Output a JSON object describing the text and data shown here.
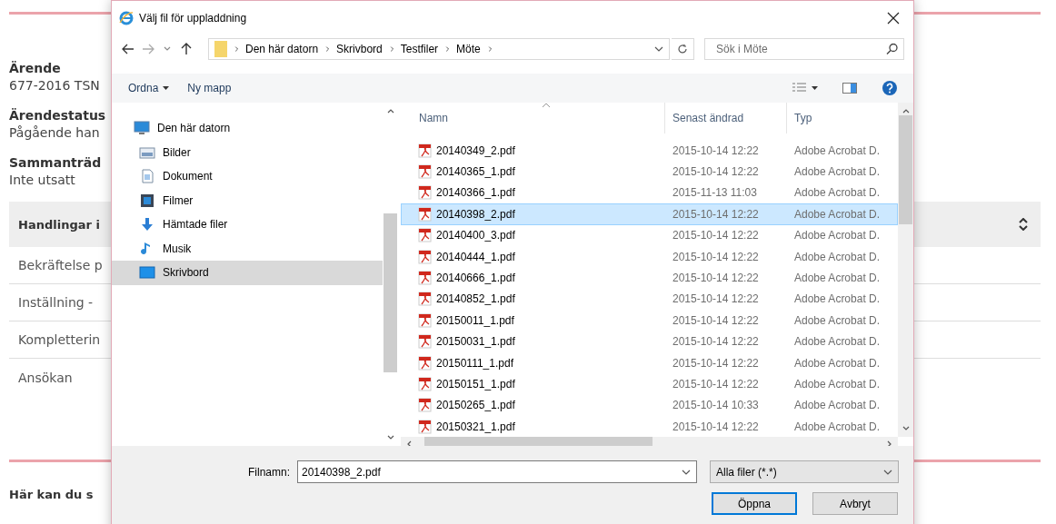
{
  "page": {
    "fields": [
      {
        "label": "Ärende",
        "value": "677-2016 TSN"
      },
      {
        "label": "Ärendestatus",
        "value": "Pågående han"
      },
      {
        "label": "Sammanträd",
        "value": "Inte utsatt"
      }
    ],
    "section": {
      "title": "Handlingar i",
      "rows": [
        "Bekräftelse p",
        "Inställning -",
        "Kompletterin",
        "Ansökan"
      ]
    },
    "footer_heading": "Här kan du s"
  },
  "dialog": {
    "title": "Välj fil för uppladdning",
    "breadcrumb": [
      "Den här datorn",
      "Skrivbord",
      "Testfiler",
      "Möte"
    ],
    "search": {
      "placeholder": "Sök i Möte"
    },
    "toolbar": [
      {
        "label": "Ordna",
        "kind": "menu"
      },
      {
        "label": "Ny mapp",
        "kind": "button"
      }
    ],
    "nav": [
      {
        "label": "Den här datorn",
        "kind": "computer",
        "selected": false
      },
      {
        "label": "Bilder",
        "kind": "pictures",
        "selected": false
      },
      {
        "label": "Dokument",
        "kind": "document",
        "selected": false
      },
      {
        "label": "Filmer",
        "kind": "video",
        "selected": false
      },
      {
        "label": "Hämtade filer",
        "kind": "download",
        "selected": false
      },
      {
        "label": "Musik",
        "kind": "music",
        "selected": false
      },
      {
        "label": "Skrivbord",
        "kind": "desktop",
        "selected": true
      }
    ],
    "columns": [
      "Namn",
      "Senast ändrad",
      "Typ"
    ],
    "files": [
      {
        "name": "20140349_2.pdf",
        "modified": "2015-10-14 12:22",
        "type": "Adobe Acrobat D.",
        "selected": false
      },
      {
        "name": "20140365_1.pdf",
        "modified": "2015-10-14 12:22",
        "type": "Adobe Acrobat D.",
        "selected": false
      },
      {
        "name": "20140366_1.pdf",
        "modified": "2015-11-13 11:03",
        "type": "Adobe Acrobat D.",
        "selected": false
      },
      {
        "name": "20140398_2.pdf",
        "modified": "2015-10-14 12:22",
        "type": "Adobe Acrobat D.",
        "selected": true
      },
      {
        "name": "20140400_3.pdf",
        "modified": "2015-10-14 12:22",
        "type": "Adobe Acrobat D.",
        "selected": false
      },
      {
        "name": "20140444_1.pdf",
        "modified": "2015-10-14 12:22",
        "type": "Adobe Acrobat D.",
        "selected": false
      },
      {
        "name": "20140666_1.pdf",
        "modified": "2015-10-14 12:22",
        "type": "Adobe Acrobat D.",
        "selected": false
      },
      {
        "name": "20140852_1.pdf",
        "modified": "2015-10-14 12:22",
        "type": "Adobe Acrobat D.",
        "selected": false
      },
      {
        "name": "20150011_1.pdf",
        "modified": "2015-10-14 12:22",
        "type": "Adobe Acrobat D.",
        "selected": false
      },
      {
        "name": "20150031_1.pdf",
        "modified": "2015-10-14 12:22",
        "type": "Adobe Acrobat D.",
        "selected": false
      },
      {
        "name": "20150111_1.pdf",
        "modified": "2015-10-14 12:22",
        "type": "Adobe Acrobat D.",
        "selected": false
      },
      {
        "name": "20150151_1.pdf",
        "modified": "2015-10-14 12:22",
        "type": "Adobe Acrobat D.",
        "selected": false
      },
      {
        "name": "20150265_1.pdf",
        "modified": "2015-10-14 10:33",
        "type": "Adobe Acrobat D.",
        "selected": false
      },
      {
        "name": "20150321_1.pdf",
        "modified": "2015-10-14 12:22",
        "type": "Adobe Acrobat D.",
        "selected": false
      }
    ],
    "filename": {
      "label": "Filnamn:",
      "value": "20140398_2.pdf"
    },
    "filter": "Alla filer (*.*)",
    "buttons": [
      {
        "label": "Öppna",
        "default": true
      },
      {
        "label": "Avbryt",
        "default": false
      }
    ]
  }
}
